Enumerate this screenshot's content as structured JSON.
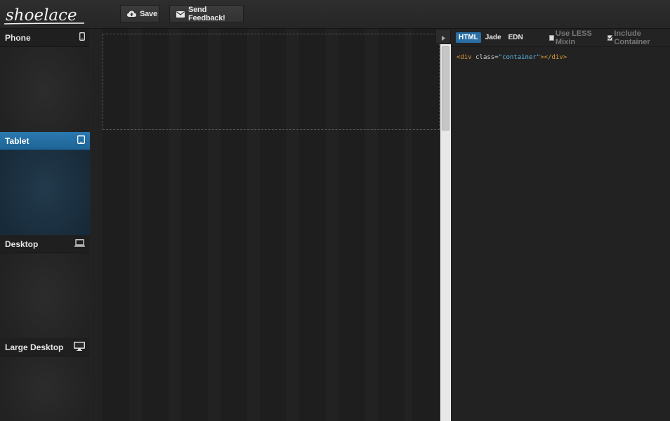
{
  "app": {
    "logo_text": "shoelace"
  },
  "toolbar": {
    "save_label": "Save",
    "feedback_label": "Send Feedback!"
  },
  "devices": [
    {
      "label": "Phone",
      "icon": "phone-icon",
      "active": false
    },
    {
      "label": "Tablet",
      "icon": "tablet-icon",
      "active": true
    },
    {
      "label": "Desktop",
      "icon": "laptop-icon",
      "active": false
    },
    {
      "label": "Large Desktop",
      "icon": "monitor-icon",
      "active": false
    }
  ],
  "code_panel": {
    "tabs": [
      {
        "label": "HTML",
        "active": true
      },
      {
        "label": "Jade",
        "active": false
      },
      {
        "label": "EDN",
        "active": false
      }
    ],
    "options": [
      {
        "label": "Use LESS Mixin",
        "checked": false
      },
      {
        "label": "Include Container",
        "checked": true
      }
    ],
    "code": {
      "open_tag": "<div",
      "attr": " class=",
      "value": "\"container\"",
      "close": "></div>"
    }
  },
  "colors": {
    "accent": "#1f6496",
    "code_tag": "#e09a3e",
    "code_string": "#5fb8e8"
  }
}
